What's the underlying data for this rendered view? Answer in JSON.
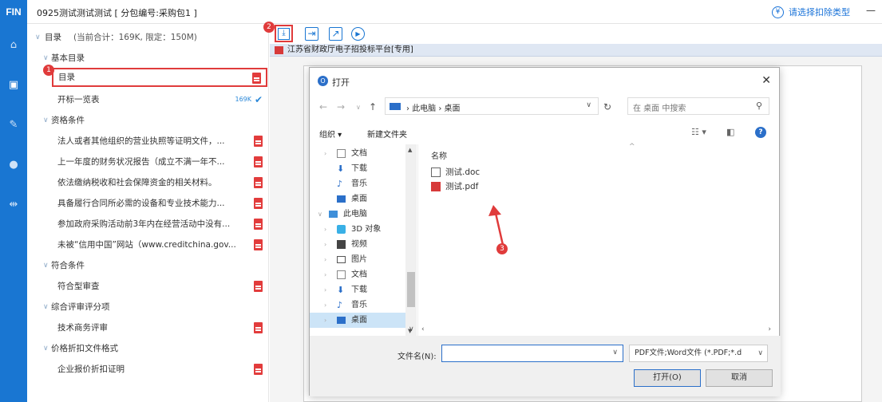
{
  "app": {
    "logo": "FIN",
    "title": "0925测试测试测试 [ 分包编号:采购包1 ]"
  },
  "header": {
    "deduct_icon": "¥",
    "deduct_label": "请选择扣除类型",
    "minimize": "—"
  },
  "tree": {
    "root_label": "目录",
    "root_stats": "(当前合计：169K, 限定：150M)",
    "groups": [
      {
        "label": "基本目录",
        "items": [
          "目录",
          "开标一览表"
        ]
      },
      {
        "label": "资格条件",
        "items": [
          "法人或者其他组织的营业执照等证明文件，...",
          "上一年度的财务状况报告（成立不满一年不...",
          "依法缴纳税收和社会保障资金的相关材料。",
          "具备履行合同所必需的设备和专业技术能力...",
          "参加政府采购活动前3年内在经营活动中没有...",
          "未被“信用中国”网站（www.creditchina.gov..."
        ]
      },
      {
        "label": "符合条件",
        "items": [
          "符合型审查"
        ]
      },
      {
        "label": "综合评审评分项",
        "items": [
          "技术商务评审"
        ]
      },
      {
        "label": "价格折扣文件格式",
        "items": [
          "企业报价折扣证明"
        ]
      }
    ],
    "size_tag": "169K"
  },
  "badges": {
    "one": "1",
    "two": "2",
    "three": "3"
  },
  "doc": {
    "tab_label": "江苏省财政厅电子招投标平台[专用]"
  },
  "dialog": {
    "title": "打开",
    "logo": "O",
    "path": [
      "此电脑",
      "桌面"
    ],
    "search_placeholder": "在 桌面 中搜索",
    "organize": "组织 ▾",
    "new_folder": "新建文件夹",
    "nav_items": [
      "文档",
      "下载",
      "音乐",
      "桌面",
      "此电脑",
      "3D 对象",
      "视频",
      "图片",
      "文档",
      "下载",
      "音乐",
      "桌面"
    ],
    "column_name": "名称",
    "files": [
      "测试.doc",
      "测试.pdf"
    ],
    "filename_label": "文件名(N):",
    "filename_value": "",
    "filter_value": "PDF文件;Word文件 (*.PDF;*.d",
    "open_button": "打开(O)",
    "cancel_button": "取消",
    "help": "?"
  }
}
